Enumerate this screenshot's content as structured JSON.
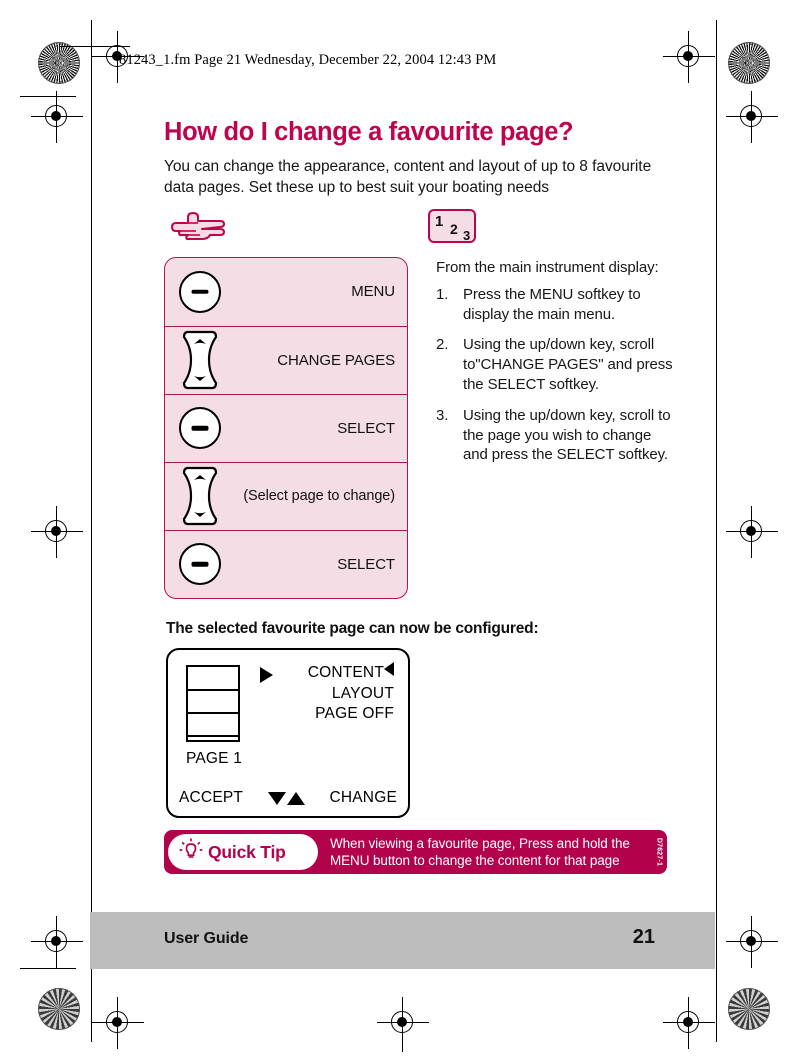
{
  "header": {
    "file_slug": "81243_1.fm  Page 21  Wednesday, December 22, 2004  12:43 PM"
  },
  "article": {
    "title": "How do I change a favourite page?",
    "intro": "You can change the appearance, content and layout of up to 8 favourite data pages. Set these up to best suit your boating needs",
    "step_badge": {
      "n1": "1",
      "n2": "2",
      "n3": "3"
    },
    "configured_heading": "The selected favourite page can now be configured:"
  },
  "keypanel": {
    "rows": [
      {
        "key": "softkey",
        "label": "MENU"
      },
      {
        "key": "rocker",
        "label": "CHANGE PAGES"
      },
      {
        "key": "softkey",
        "label": "SELECT"
      },
      {
        "key": "rocker",
        "label": "(Select page to change)"
      },
      {
        "key": "softkey",
        "label": "SELECT"
      }
    ]
  },
  "steps": {
    "lead": "From the main instrument display:",
    "items": [
      {
        "num": "1.",
        "text": "Press the MENU softkey to display the main menu."
      },
      {
        "num": "2.",
        "text": "Using the up/down key, scroll to\"CHANGE PAGES\" and press the SELECT softkey."
      },
      {
        "num": "3.",
        "text": "Using the up/down key, scroll to the page you wish to change and press the SELECT softkey."
      }
    ]
  },
  "display": {
    "page_label": "PAGE 1",
    "menu_items": [
      "CONTENT",
      "LAYOUT",
      "PAGE OFF"
    ],
    "softkey_left": "ACCEPT",
    "softkey_right": "CHANGE"
  },
  "quicktip": {
    "label": "Quick Tip",
    "text": "When viewing a favourite page, Press and hold the MENU button to change the content for that page",
    "code": "D7627-1"
  },
  "footer": {
    "left": "User Guide",
    "page": "21"
  },
  "colors": {
    "brand_crimson": "#C1024E",
    "tip_bar": "#B2024C",
    "panel_pink": "#F4DDE4",
    "footer_gray": "#BDBDBD"
  }
}
